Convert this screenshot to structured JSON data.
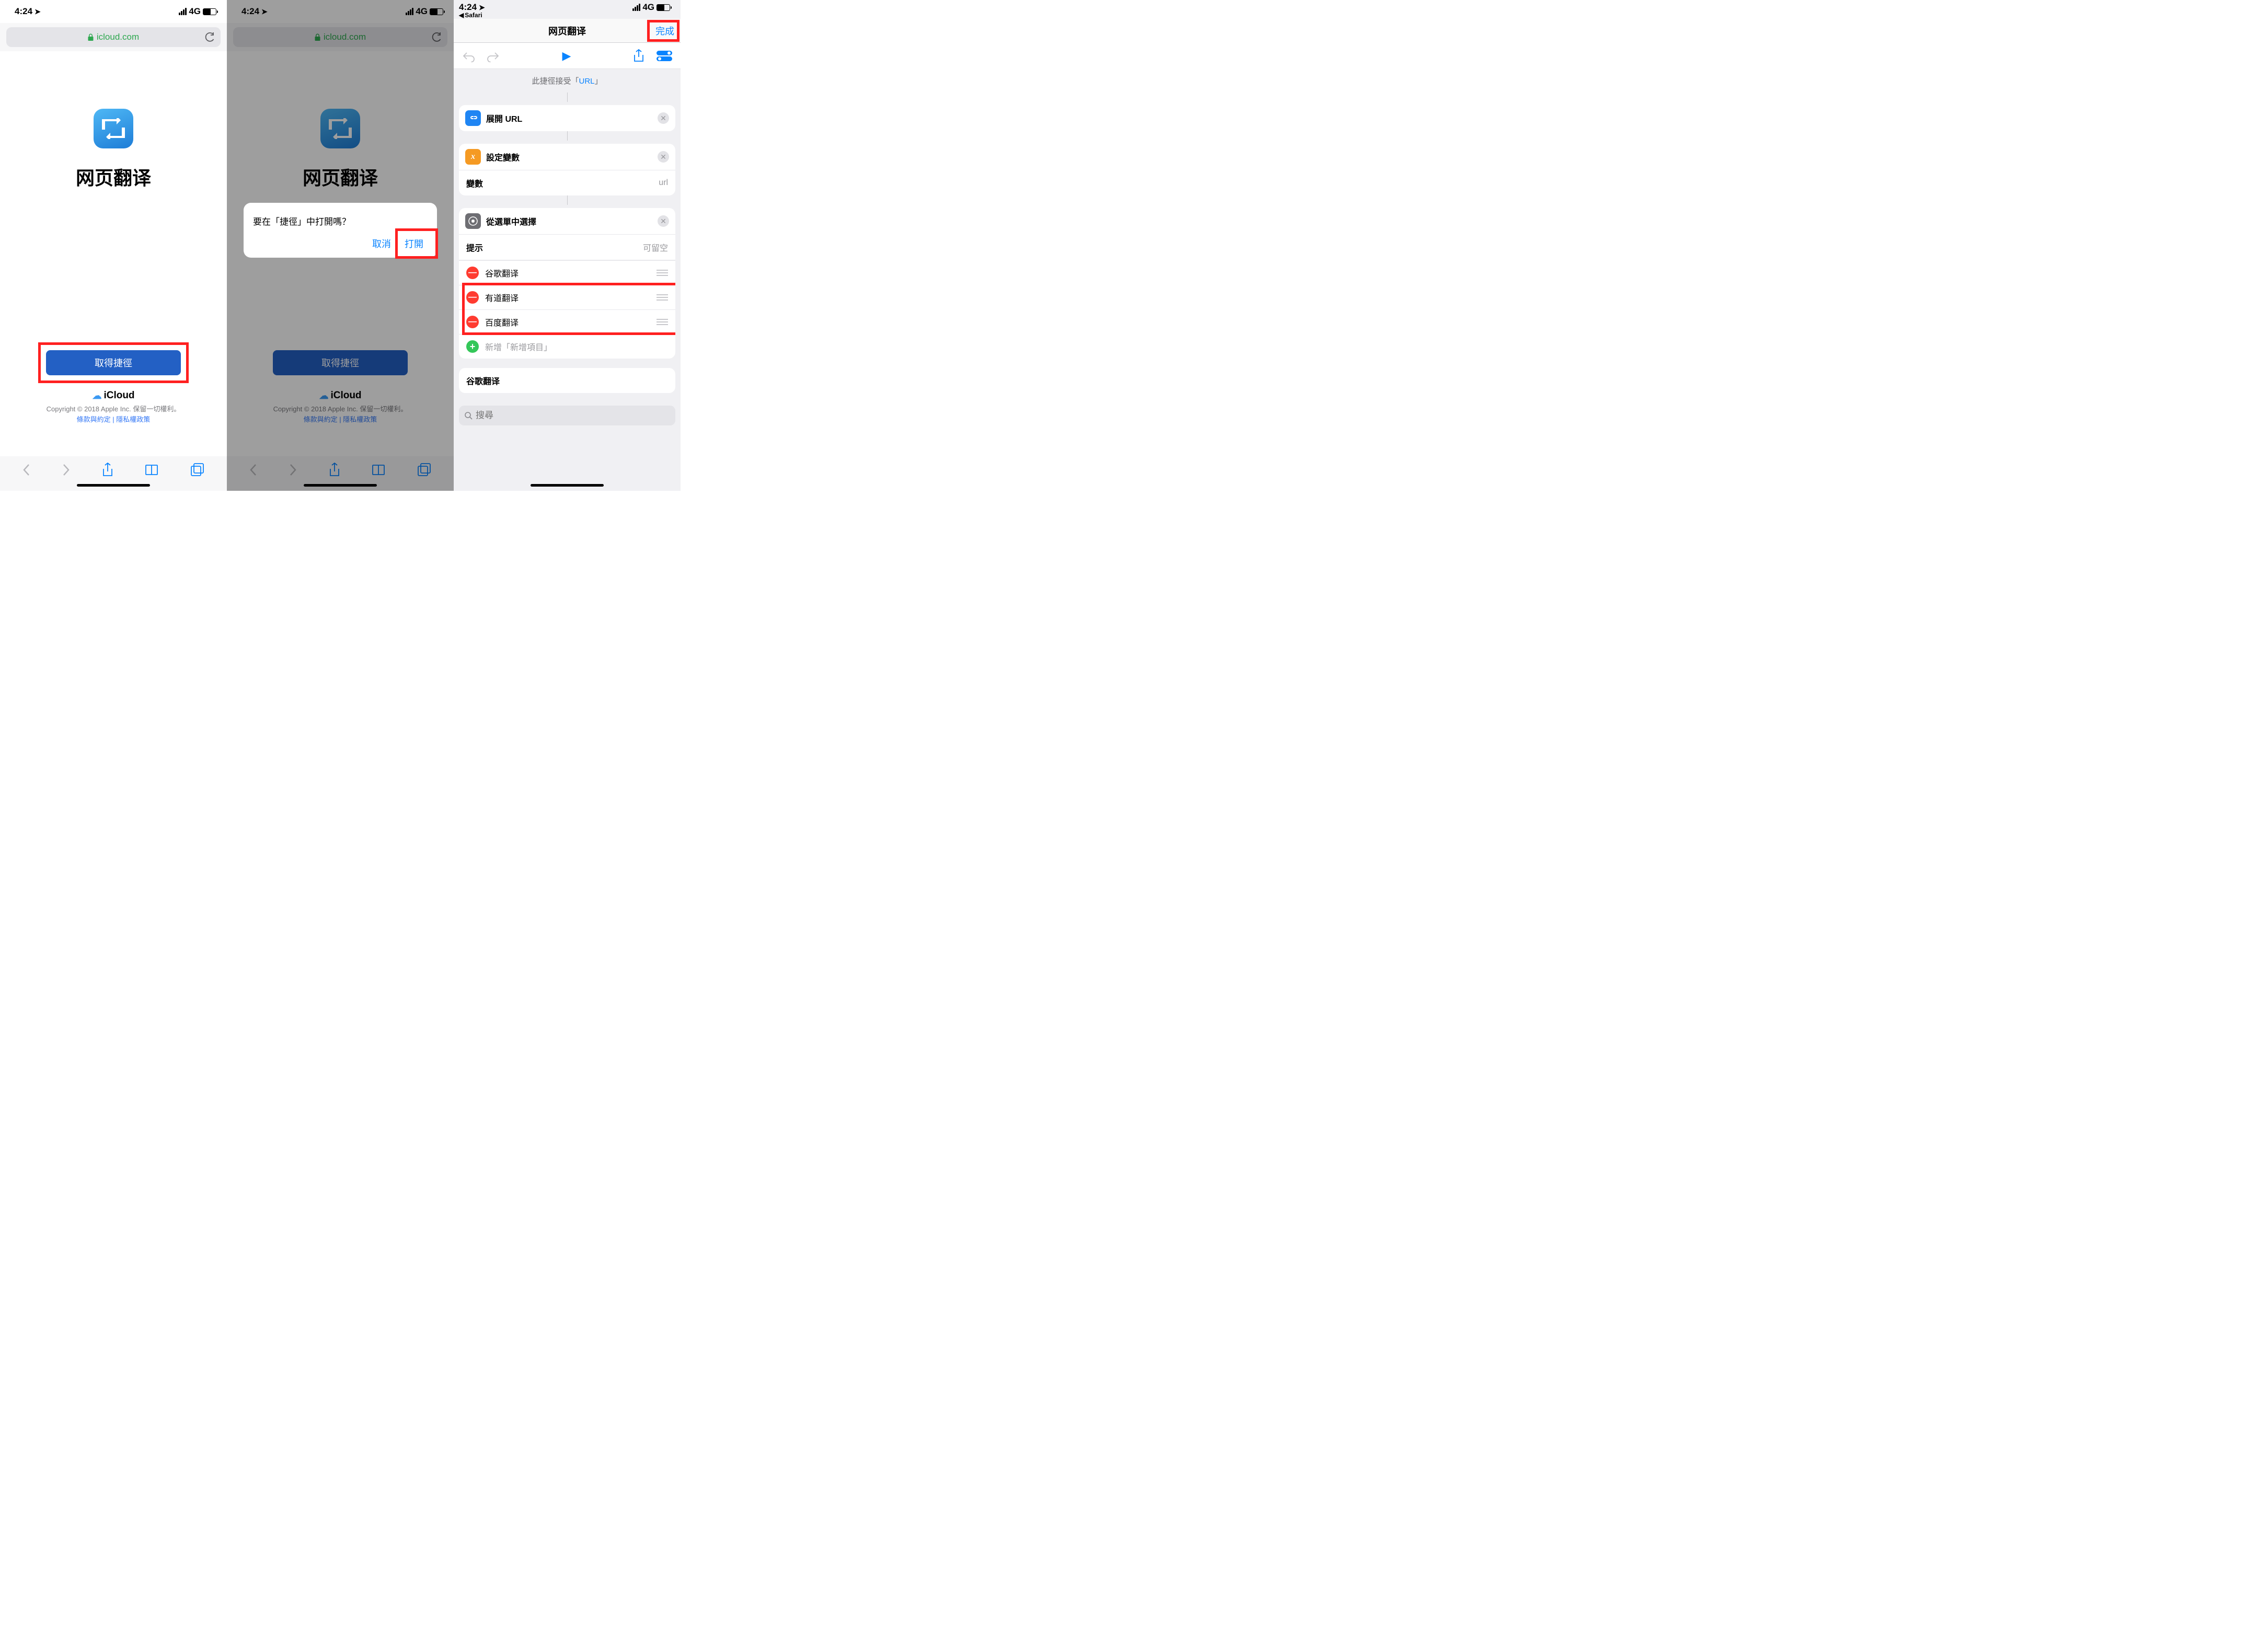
{
  "status": {
    "time": "4:24",
    "network": "4G",
    "back_app": "Safari"
  },
  "safari": {
    "domain": "icloud.com"
  },
  "shortcut_page": {
    "title": "网页翻译",
    "get_button": "取得捷徑",
    "icloud_brand": "iCloud",
    "copyright": "Copyright © 2018 Apple Inc. 保留一切權利。",
    "terms": "條款與約定",
    "privacy": "隱私權政策",
    "sep": " | "
  },
  "alert": {
    "message": "要在「捷徑」中打開嗎？",
    "cancel": "取消",
    "open": "打開"
  },
  "editor": {
    "title": "网页翻译",
    "done": "完成",
    "accepts_prefix": "此捷徑接受「",
    "accepts_type": "URL",
    "accepts_suffix": "」",
    "actions": {
      "expand": "展開 URL",
      "setvar": "設定變數",
      "var_label": "變數",
      "var_value": "url",
      "choose": "從選單中選擇",
      "prompt_label": "提示",
      "prompt_placeholder": "可留空",
      "items": [
        "谷歌翻译",
        "有道翻译",
        "百度翻译"
      ],
      "add_item": "新增「新增項目」"
    },
    "result": "谷歌翻译",
    "search_placeholder": "搜尋"
  }
}
